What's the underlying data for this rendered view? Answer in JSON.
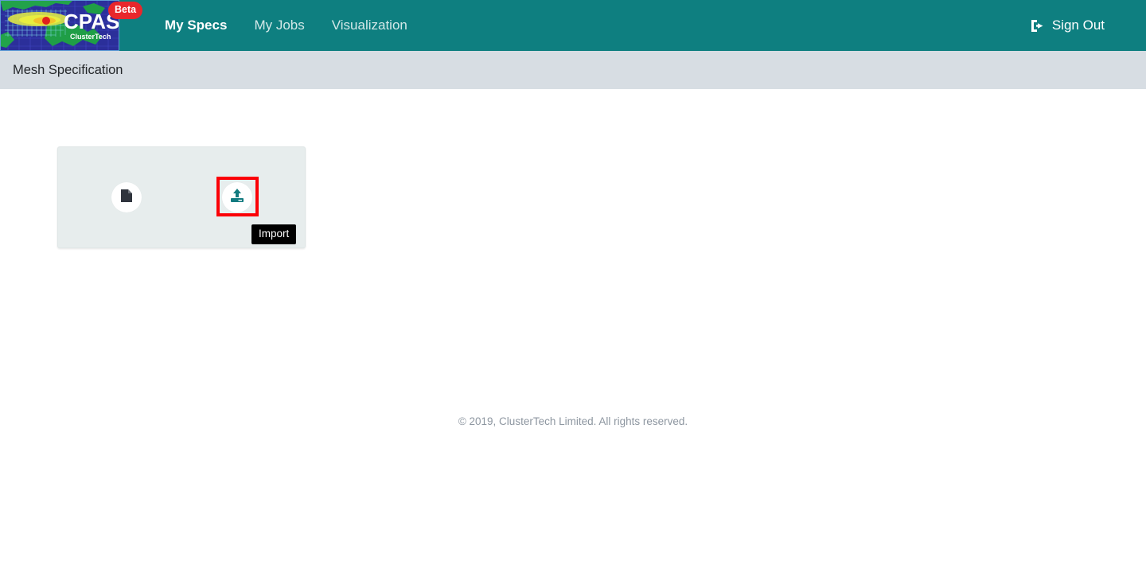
{
  "app": {
    "brand_name": "CPAS",
    "brand_sub": "ClusterTech",
    "beta_label": "Beta"
  },
  "navbar": {
    "links": [
      {
        "label": "My Specs",
        "active": true
      },
      {
        "label": "My Jobs",
        "active": false
      },
      {
        "label": "Visualization",
        "active": false
      }
    ],
    "sign_out_label": "Sign Out",
    "sign_out_icon": "sign-out-icon",
    "background_color": "#0e7f80"
  },
  "subheader": {
    "title": "Mesh Specification",
    "background_color": "#d7dde3"
  },
  "main": {
    "card": {
      "file_icon": "file-icon",
      "import_icon": "upload-icon",
      "background_color": "#e7eded"
    },
    "highlight": {
      "color": "#fb0007"
    },
    "tooltip": {
      "text": "Import",
      "background_color": "#000000"
    }
  },
  "footer": {
    "copyright": "© 2019, ClusterTech Limited. All rights reserved."
  }
}
